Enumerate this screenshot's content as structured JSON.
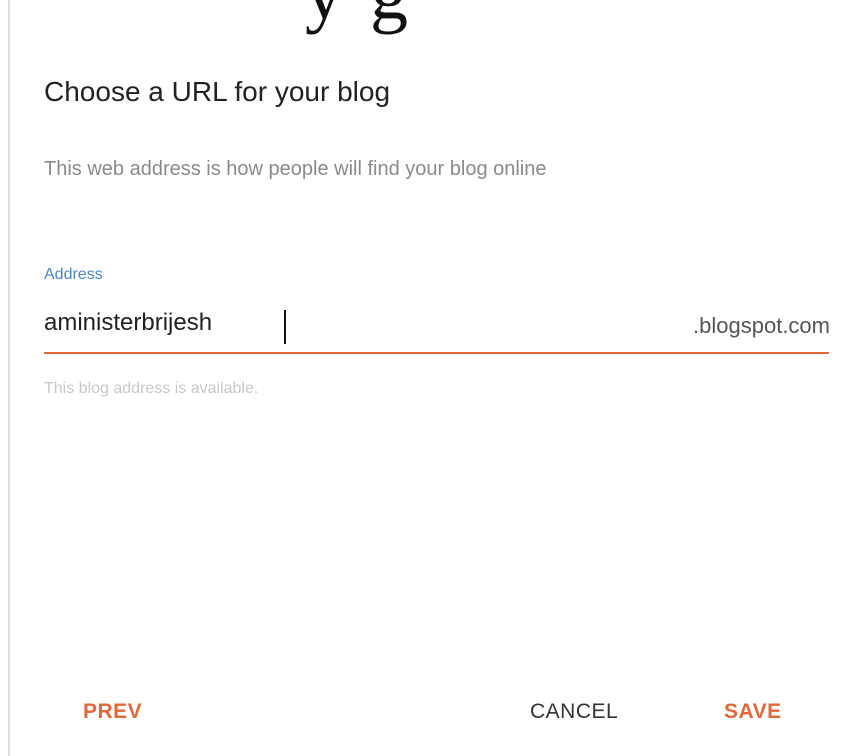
{
  "header": {
    "partial_heading": "y      g"
  },
  "dialog": {
    "title": "Choose a URL for your blog",
    "subtitle": "This web address is how people will find your blog online",
    "address_field": {
      "label": "Address",
      "value": "aministerbrijesh",
      "suffix": ".blogspot.com",
      "helper": "This blog address is available."
    },
    "buttons": {
      "prev": "PREV",
      "cancel": "CANCEL",
      "save": "SAVE"
    },
    "colors": {
      "accent": "#e0683a",
      "label": "#4a86c8"
    }
  }
}
